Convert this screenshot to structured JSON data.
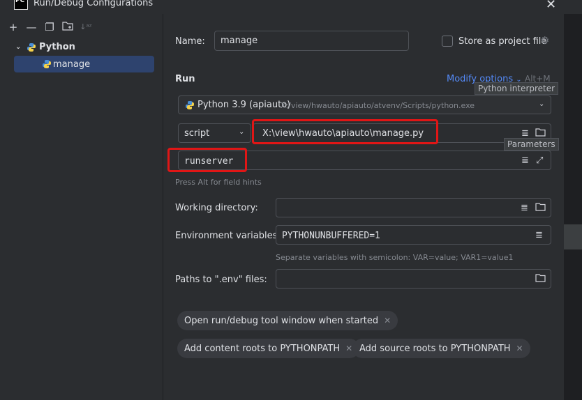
{
  "window": {
    "title": "Run/Debug Configurations",
    "app_icon": "PC"
  },
  "toolbar": {
    "icons": [
      "add-icon",
      "remove-icon",
      "copy-icon",
      "new-folder-icon",
      "sort-icon"
    ]
  },
  "tree": {
    "group_label": "Python",
    "item_label": "manage"
  },
  "form": {
    "name_label": "Name:",
    "name_value": "manage",
    "store_label": "Store as project file",
    "run_label": "Run",
    "modify_options": "Modify options",
    "modify_shortcut": "Alt+M",
    "interpreter_tooltip": "Python interpreter",
    "interpreter_name": "Python 3.9 (apiauto)",
    "interpreter_path": "X:/view/hwauto/apiauto/atvenv/Scripts/python.exe",
    "script_type": "script",
    "script_path": "X:\\view\\hwauto\\apiauto\\manage.py",
    "parameters_tooltip": "Parameters",
    "parameters_value": "runserver",
    "field_hint": "Press Alt for field hints",
    "working_dir_label": "Working directory:",
    "working_dir_value": "",
    "env_label": "Environment variables:",
    "env_value": "PYTHONUNBUFFERED=1",
    "env_hint": "Separate variables with semicolon: VAR=value; VAR1=value1",
    "env_files_label": "Paths to \".env\" files:",
    "env_files_value": ""
  },
  "chips": [
    {
      "label": "Open run/debug tool window when started"
    },
    {
      "label": "Add content roots to PYTHONPATH"
    },
    {
      "label": "Add source roots to PYTHONPATH"
    }
  ],
  "colors": {
    "background": "#2b2d30",
    "accent": "#548af7",
    "selection": "#2e436e",
    "highlight_box": "#e01616"
  }
}
